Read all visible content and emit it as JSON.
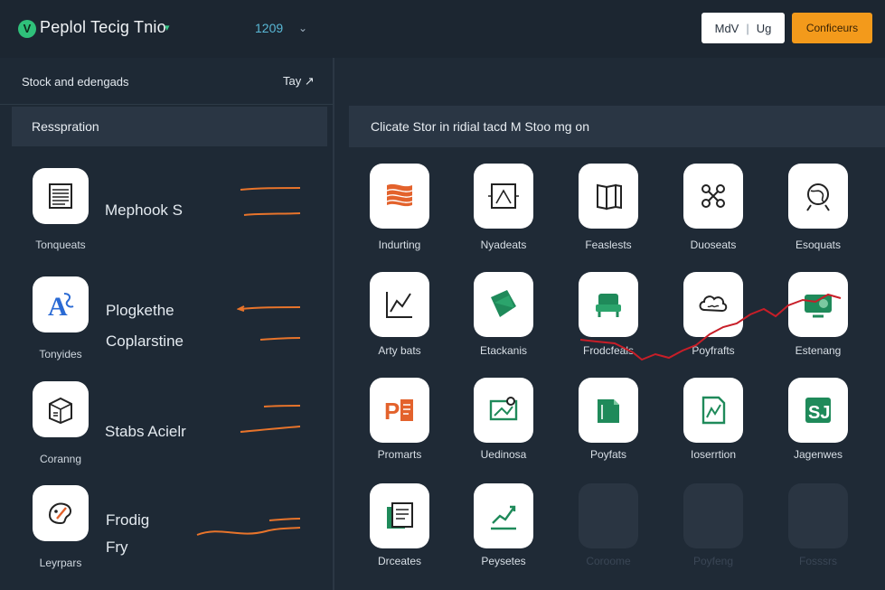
{
  "topbar": {
    "brand_mark": "V",
    "title": "Peplol Tecig Tnio",
    "brand_chevron": "▾",
    "year_select": "1209",
    "year_chevron": "⌄",
    "btn_left_a": "MdV",
    "btn_left_sep": "|",
    "btn_left_b": "Ug",
    "btn_primary": "Conficeurs"
  },
  "left": {
    "header_title": "Stock and edengads",
    "header_action": "Tay ↗",
    "sub_title": "Resspration",
    "rows": [
      {
        "caption": "Tonqueats",
        "text1": "Mephook S",
        "text2": "",
        "icon": "document-stack-icon"
      },
      {
        "caption": "Tonyides",
        "text1": "Plogkethe",
        "text2": "Coplarstine",
        "icon": "typography-icon"
      },
      {
        "caption": "Coranng",
        "text1": "Stabs Acielr",
        "text2": "",
        "icon": "box-icon"
      },
      {
        "caption": "Leyrpars",
        "text1": "Frodig",
        "text2": "Fry",
        "icon": "palette-icon"
      }
    ]
  },
  "right": {
    "sub_title": "Clicate Stor in ridial tacd M Stoo mg on",
    "tiles": [
      {
        "label": "Indurting",
        "icon": "flag-icon",
        "faded": false
      },
      {
        "label": "Nyadeats",
        "icon": "frame-icon",
        "faded": false
      },
      {
        "label": "Feaslests",
        "icon": "book-icon",
        "faded": false
      },
      {
        "label": "Duoseats",
        "icon": "network-icon",
        "faded": false
      },
      {
        "label": "Esoquats",
        "icon": "globe-icon",
        "faded": false
      },
      {
        "label": "Arty bats",
        "icon": "line-chart-icon",
        "faded": false
      },
      {
        "label": "Etackanis",
        "icon": "sheets-icon",
        "faded": false
      },
      {
        "label": "Frodcfeals",
        "icon": "chair-icon",
        "faded": false
      },
      {
        "label": "Poyfrafts",
        "icon": "cloud-icon",
        "faded": false
      },
      {
        "label": "Estenang",
        "icon": "monitor-icon",
        "faded": false
      },
      {
        "label": "Promarts",
        "icon": "presentation-icon",
        "faded": false
      },
      {
        "label": "Uedinosa",
        "icon": "board-icon",
        "faded": false
      },
      {
        "label": "Poyfats",
        "icon": "folder-icon",
        "faded": false
      },
      {
        "label": "Ioserrtion",
        "icon": "chart-doc-icon",
        "faded": false
      },
      {
        "label": "Jagenwes",
        "icon": "spreadsheet-icon",
        "faded": false
      },
      {
        "label": "Drceates",
        "icon": "notes-icon",
        "faded": false
      },
      {
        "label": "Peysetes",
        "icon": "growth-icon",
        "faded": false
      },
      {
        "label": "Coroome",
        "icon": "placeholder-icon",
        "faded": true
      },
      {
        "label": "Poyfeng",
        "icon": "placeholder-icon",
        "faded": true
      },
      {
        "label": "Fosssrs",
        "icon": "placeholder-icon",
        "faded": true
      }
    ]
  },
  "colors": {
    "background": "#1f2a36",
    "accent_green": "#2fc07a",
    "accent_orange": "#f39a1b",
    "icon_orange": "#e3622c",
    "icon_green": "#1f8a5a",
    "trend_red": "#c81e28"
  }
}
